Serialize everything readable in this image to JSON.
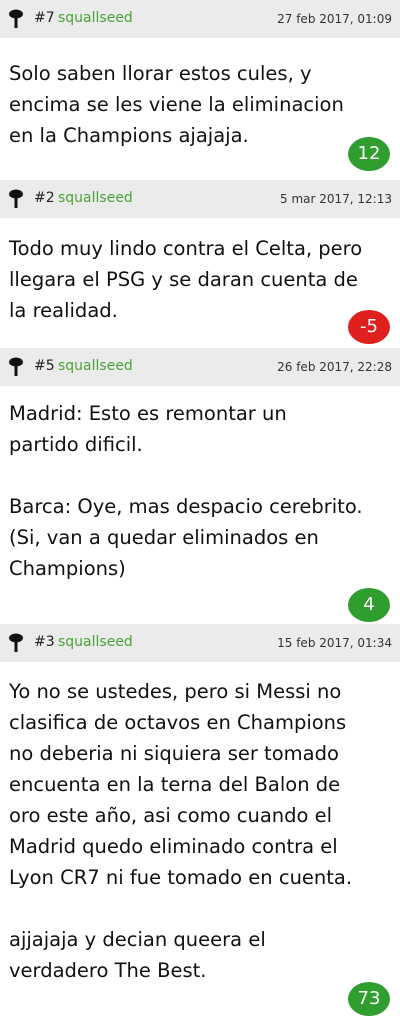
{
  "comments": [
    {
      "number": "#7",
      "user": "squallseed",
      "date": "27 feb 2017, 01:09",
      "text": "Solo saben llorar estos cules, y\nencima se les viene la eliminacion\nen la Champions ajajaja.",
      "score": "12",
      "score_type": "positive"
    },
    {
      "number": "#2",
      "user": "squallseed",
      "date": "5 mar 2017, 12:13",
      "text": "Todo muy lindo contra el Celta, pero\nllegara el PSG y se daran cuenta de\nla realidad.",
      "score": "-5",
      "score_type": "negative"
    },
    {
      "number": "#5",
      "user": "squallseed",
      "date": "26 feb 2017, 22:28",
      "text": "Madrid: Esto es remontar un\npartido dificil.\n\nBarca: Oye, mas despacio cerebrito.\n(Si, van a quedar eliminados en\nChampions)",
      "score": "4",
      "score_type": "positive"
    },
    {
      "number": "#3",
      "user": "squallseed",
      "date": "15 feb 2017, 01:34",
      "text": "Yo no se ustedes, pero si Messi no\nclasifica de octavos en Champions\nno deberia ni siquiera ser tomado\nencuenta en la terna del Balon de\noro este año, asi como cuando el\nMadrid quedo eliminado contra el\nLyon CR7 ni fue tomado en cuenta.\n\najjajaja y decian queera el\nverdadero The Best.",
      "score": "73",
      "score_type": "positive"
    }
  ],
  "colors": {
    "header_bg": "#ebebeb",
    "username": "#4aa336",
    "badge_positive": "#2f9e2f",
    "badge_negative": "#e01f1f"
  },
  "icons": {
    "pin": "pushpin-icon"
  }
}
